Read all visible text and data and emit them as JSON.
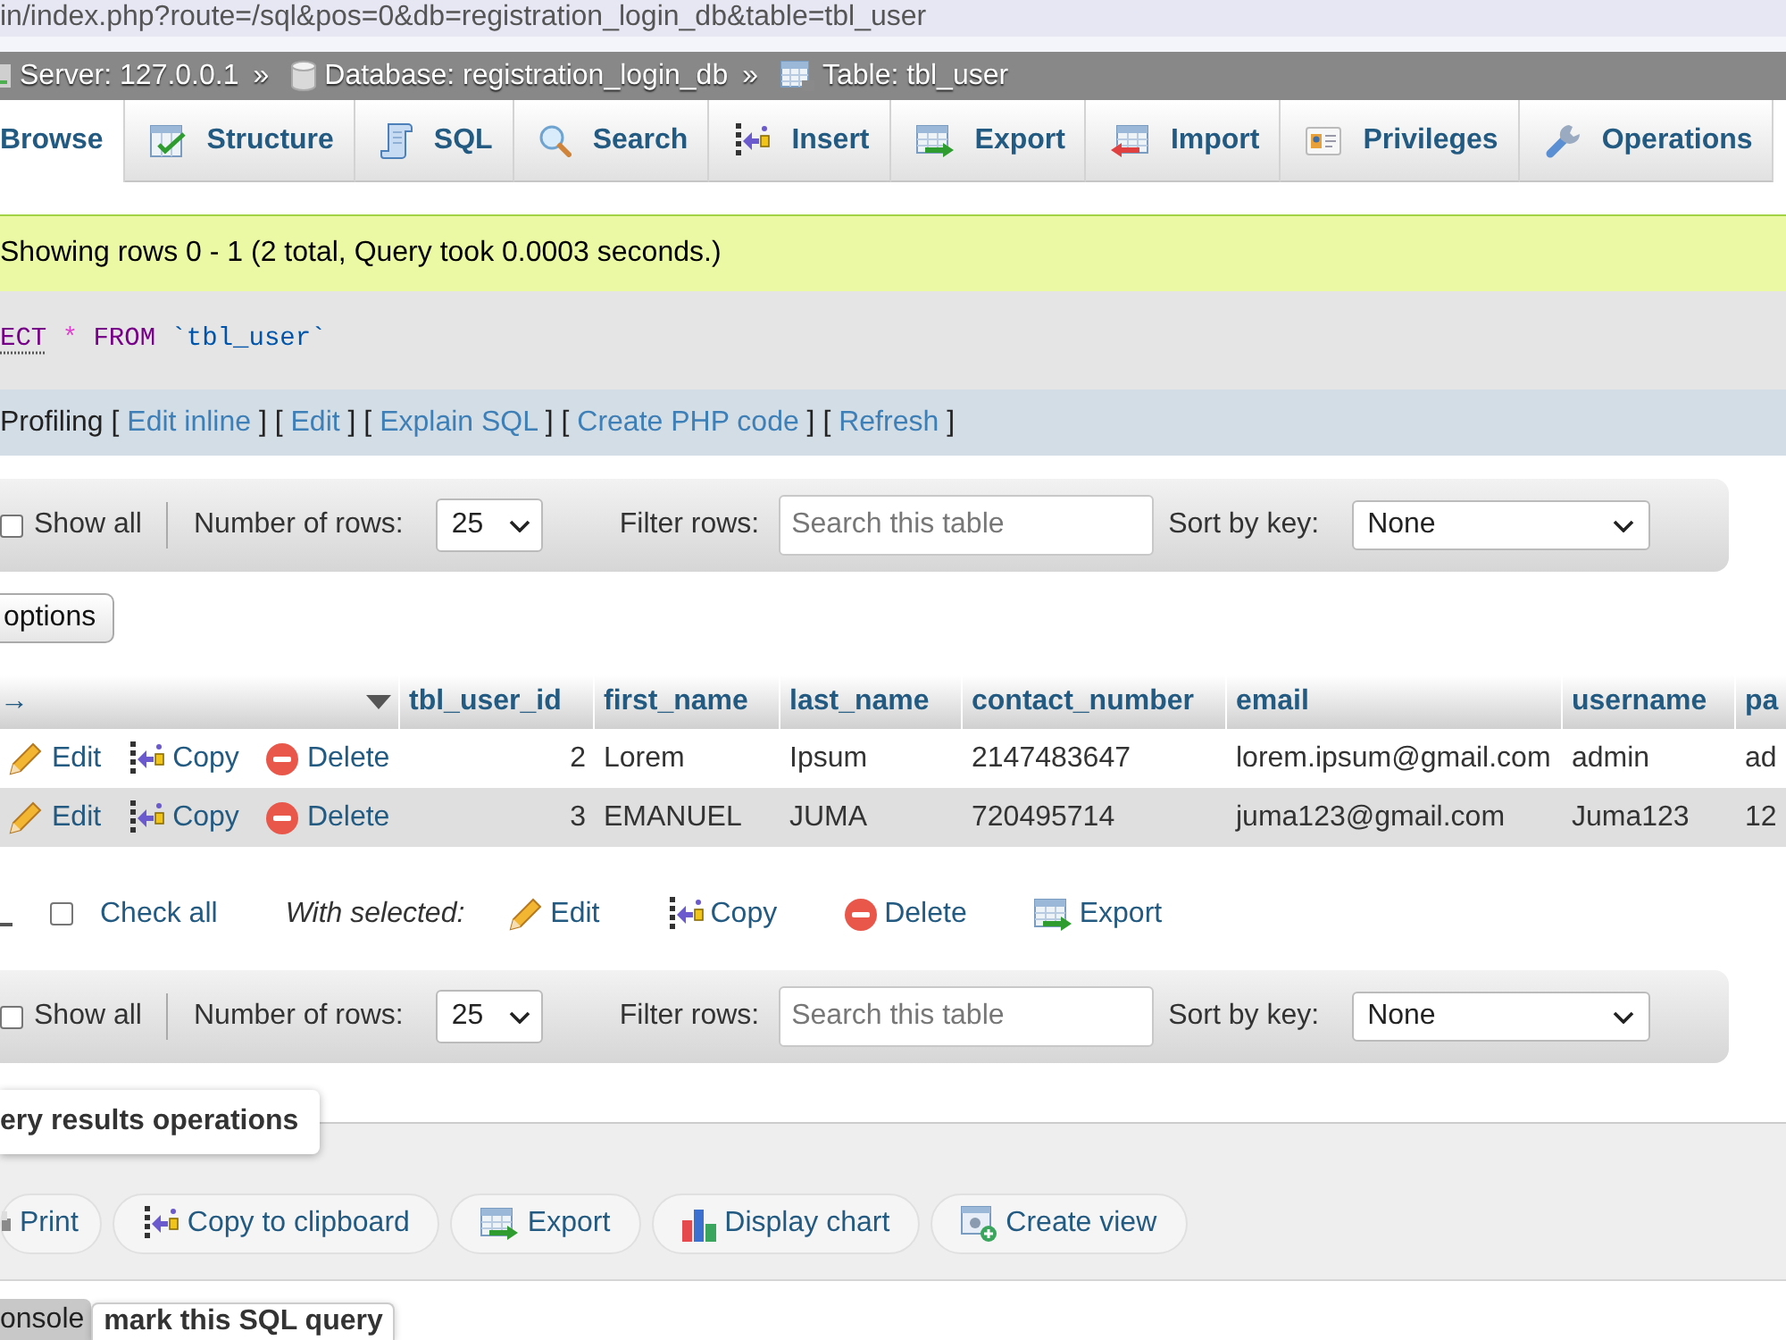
{
  "address_bar": {
    "url": "in/index.php?route=/sql&pos=0&db=registration_login_db&table=tbl_user"
  },
  "breadcrumb": [
    {
      "kind": "server",
      "label": "Server: 127.0.0.1",
      "separator": "»"
    },
    {
      "kind": "database",
      "label": "Database: registration_login_db",
      "separator": "»"
    },
    {
      "kind": "table",
      "label": "Table: tbl_user"
    }
  ],
  "tabs": [
    {
      "kind": "browse",
      "label": "Browse",
      "selected": true
    },
    {
      "kind": "structure",
      "label": "Structure",
      "selected": false
    },
    {
      "kind": "sql",
      "label": "SQL",
      "selected": false
    },
    {
      "kind": "search",
      "label": "Search",
      "selected": false
    },
    {
      "kind": "insert",
      "label": "Insert",
      "selected": false
    },
    {
      "kind": "export",
      "label": "Export",
      "selected": false
    },
    {
      "kind": "import",
      "label": "Import",
      "selected": false
    },
    {
      "kind": "privileges",
      "label": "Privileges",
      "selected": false
    },
    {
      "kind": "operations",
      "label": "Operations",
      "selected": false
    }
  ],
  "message": "Showing rows 0 - 1 (2 total, Query took 0.0003 seconds.)",
  "sql_query": [
    {
      "kind": "keyword",
      "text": "ECT",
      "doc_link": true
    },
    {
      "kind": "operator",
      "text": "*",
      "doc_link": false
    },
    {
      "kind": "keyword",
      "text": "FROM",
      "doc_link": false
    },
    {
      "kind": "identifier",
      "text": "`tbl_user`",
      "doc_link": false
    }
  ],
  "query_actions": [
    {
      "kind": "text",
      "text": "Profiling ["
    },
    {
      "kind": "link",
      "text": "Edit inline"
    },
    {
      "kind": "text",
      "text": "] ["
    },
    {
      "kind": "link",
      "text": "Edit"
    },
    {
      "kind": "text",
      "text": "] ["
    },
    {
      "kind": "link",
      "text": "Explain SQL"
    },
    {
      "kind": "text",
      "text": "] ["
    },
    {
      "kind": "link",
      "text": "Create PHP code"
    },
    {
      "kind": "text",
      "text": "] ["
    },
    {
      "kind": "link",
      "text": "Refresh"
    },
    {
      "kind": "text",
      "text": "]"
    }
  ],
  "top_navigation": {
    "show_all": {
      "label": "Show all",
      "checked": false
    },
    "rows_label": "Number of rows:",
    "rows_value": "25",
    "filter_label": "Filter rows:",
    "filter_placeholder": "Search this table",
    "sort_label": "Sort by key:",
    "sort_value": "None"
  },
  "options_button": "options",
  "table": {
    "header_arrow": "→",
    "columns": [
      "tbl_user_id",
      "first_name",
      "last_name",
      "contact_number",
      "email",
      "username",
      "pa"
    ],
    "rows": [
      {
        "actions": [
          {
            "kind": "edit",
            "label": "Edit"
          },
          {
            "kind": "copy",
            "label": "Copy"
          },
          {
            "kind": "delete",
            "label": "Delete"
          }
        ],
        "cells": [
          "2",
          "Lorem",
          "Ipsum",
          "2147483647",
          "lorem.ipsum@gmail.com",
          "admin",
          "ad"
        ]
      },
      {
        "actions": [
          {
            "kind": "edit",
            "label": "Edit"
          },
          {
            "kind": "copy",
            "label": "Copy"
          },
          {
            "kind": "delete",
            "label": "Delete"
          }
        ],
        "cells": [
          "3",
          "EMANUEL",
          "JUMA",
          "720495714",
          "juma123@gmail.com",
          "Juma123",
          "12"
        ]
      }
    ]
  },
  "bulk_actions": {
    "check_all": {
      "label": "Check all",
      "checked": false
    },
    "with_selected": "With selected:",
    "actions": [
      {
        "kind": "edit",
        "label": "Edit"
      },
      {
        "kind": "copy",
        "label": "Copy"
      },
      {
        "kind": "delete",
        "label": "Delete"
      },
      {
        "kind": "export",
        "label": "Export"
      }
    ]
  },
  "bottom_navigation": {
    "show_all": {
      "label": "Show all",
      "checked": false
    },
    "rows_label": "Number of rows:",
    "rows_value": "25",
    "filter_label": "Filter rows:",
    "filter_placeholder": "Search this table",
    "sort_label": "Sort by key:",
    "sort_value": "None"
  },
  "results_operations": {
    "legend": "ery results operations",
    "actions": [
      {
        "kind": "print",
        "label": "Print"
      },
      {
        "kind": "copy",
        "label": "Copy to clipboard"
      },
      {
        "kind": "export",
        "label": "Export"
      },
      {
        "kind": "chart",
        "label": "Display chart"
      },
      {
        "kind": "view",
        "label": "Create view"
      }
    ]
  },
  "bookmark": {
    "legend": "mark this SQL query"
  },
  "console": {
    "label": "onsole"
  }
}
